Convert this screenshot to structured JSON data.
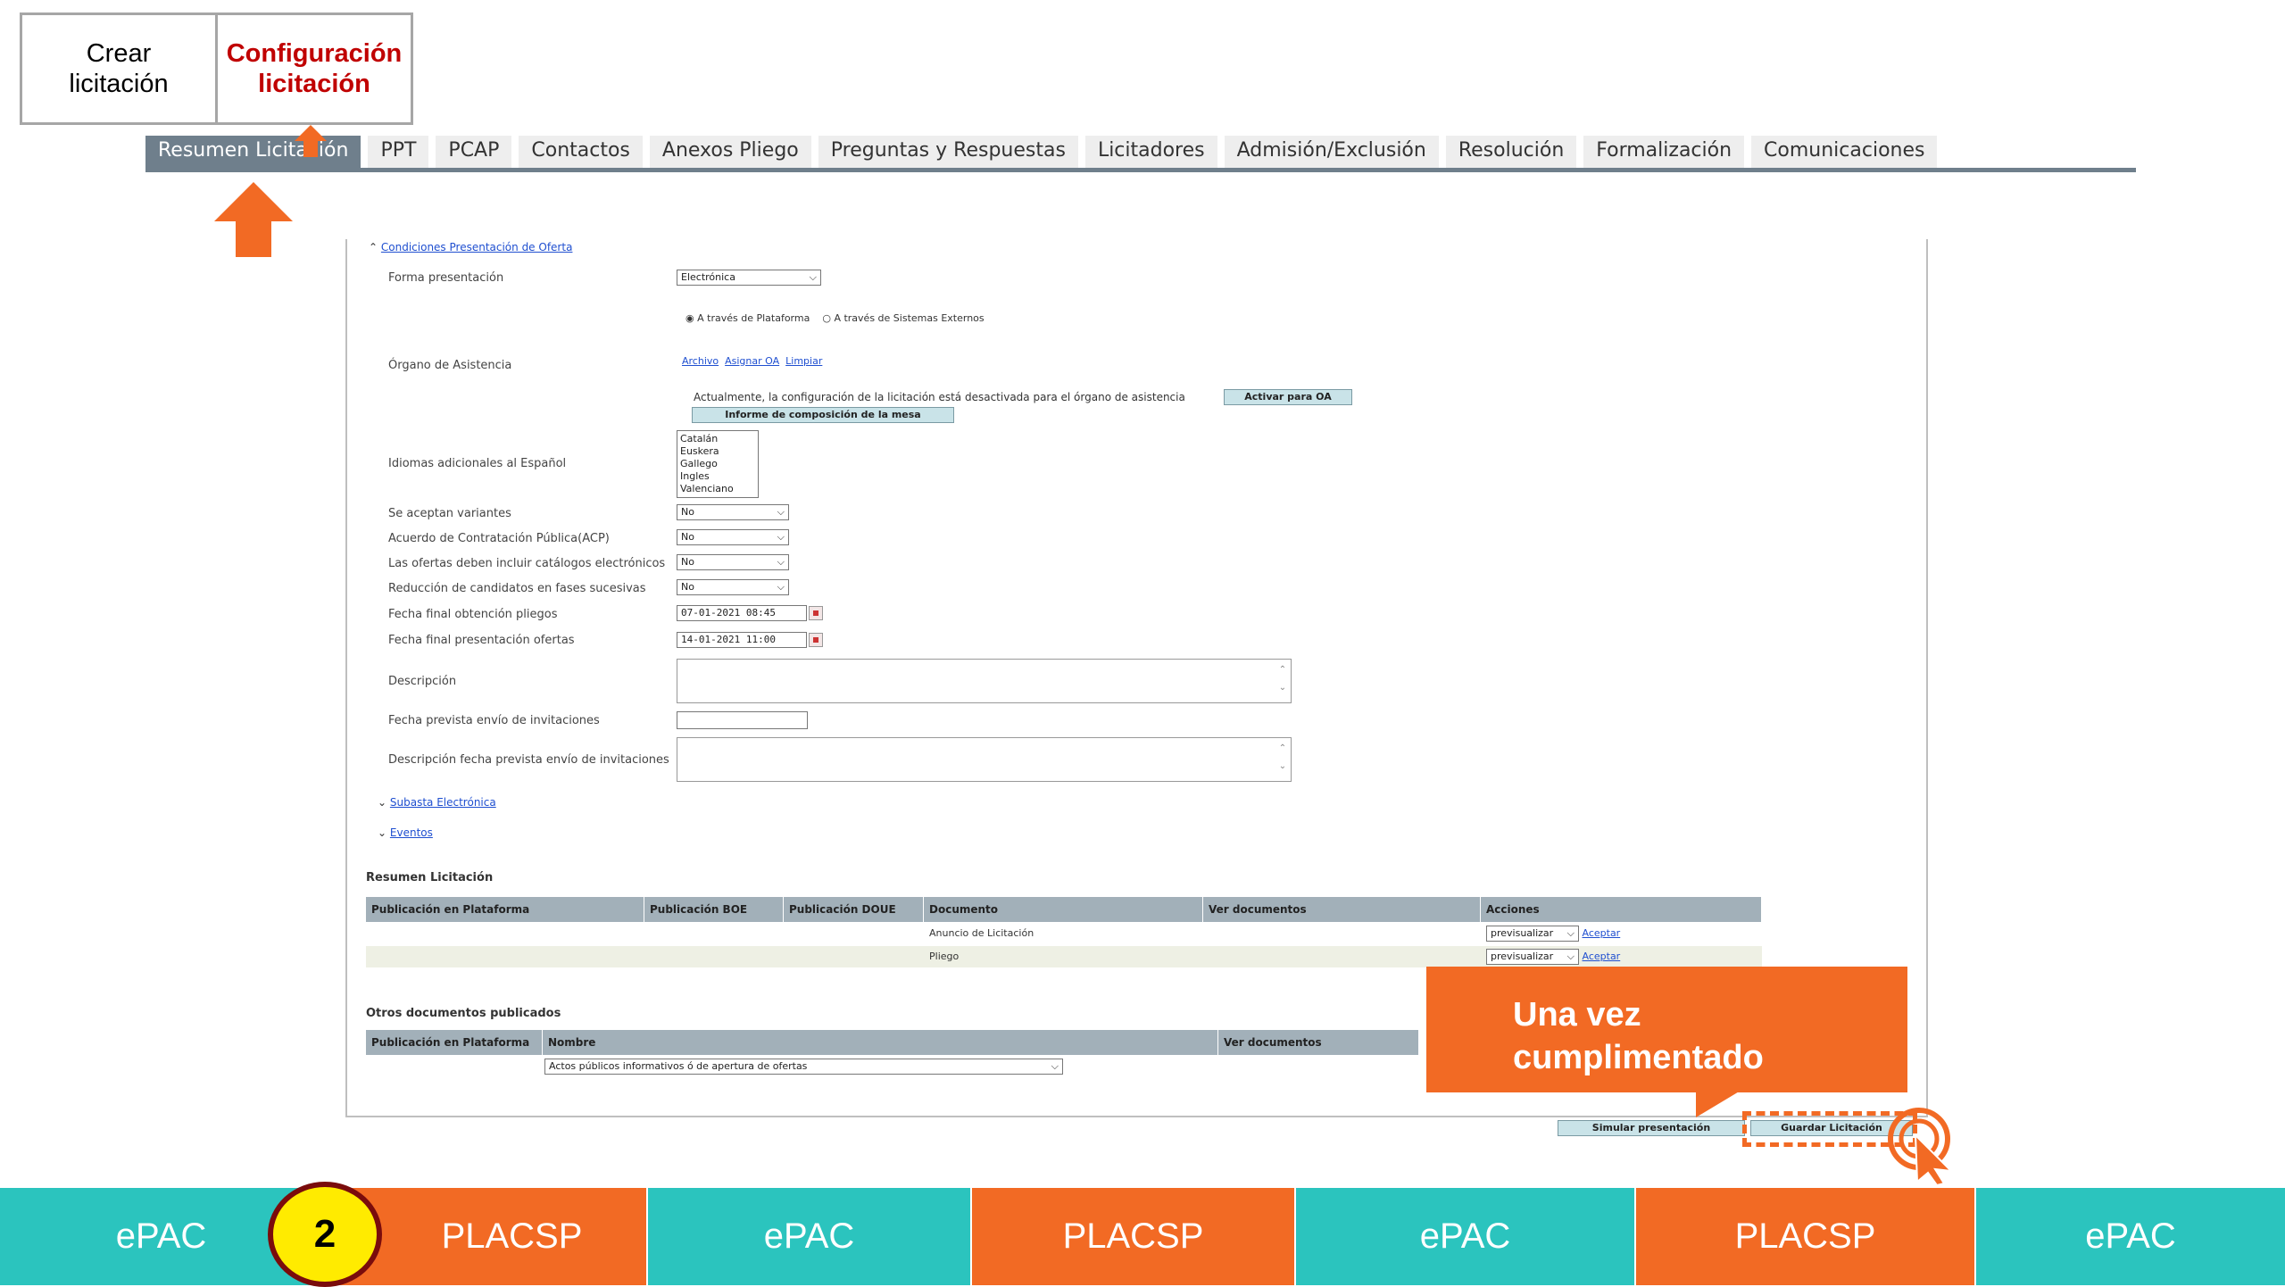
{
  "steps": {
    "first": "Crear\nlicitación",
    "second": "Configuración\nlicitación"
  },
  "tabs": [
    {
      "label": "Resumen Licitación",
      "active": true
    },
    {
      "label": "PPT",
      "active": false
    },
    {
      "label": "PCAP",
      "active": false
    },
    {
      "label": "Contactos",
      "active": false
    },
    {
      "label": "Anexos Pliego",
      "active": false
    },
    {
      "label": "Preguntas y Respuestas",
      "active": false
    },
    {
      "label": "Licitadores",
      "active": false
    },
    {
      "label": "Admisión/Exclusión",
      "active": false
    },
    {
      "label": "Resolución",
      "active": false
    },
    {
      "label": "Formalización",
      "active": false
    },
    {
      "label": "Comunicaciones",
      "active": false
    }
  ],
  "form": {
    "section_title": "Condiciones Presentación de Oferta",
    "forma_presentacion": {
      "label": "Forma presentación",
      "value": "Electrónica"
    },
    "radio_plataforma": "A través de Plataforma",
    "radio_externos": "A través de Sistemas Externos",
    "organo": {
      "label": "Órgano de Asistencia",
      "links": [
        "Archivo",
        "Asignar OA",
        "Limpiar"
      ]
    },
    "organo_note": "Actualmente, la configuración de la licitación está desactivada para el órgano de asistencia",
    "activar_oa": "Activar para OA",
    "informe": "Informe de composición de la mesa",
    "idiomas": {
      "label": "Idiomas adicionales al Español",
      "options": [
        "Catalán",
        "Euskera",
        "Gallego",
        "Ingles",
        "Valenciano"
      ]
    },
    "variantes": {
      "label": "Se aceptan variantes",
      "value": "No"
    },
    "acp": {
      "label": "Acuerdo de Contratación Pública(ACP)",
      "value": "No"
    },
    "catalogos": {
      "label": "Las ofertas deben incluir catálogos electrónicos",
      "value": "No"
    },
    "reduccion": {
      "label": "Reducción de candidatos en fases sucesivas",
      "value": "No"
    },
    "fecha_pliegos": {
      "label": "Fecha final obtención pliegos",
      "value": "07-01-2021 08:45"
    },
    "fecha_ofertas": {
      "label": "Fecha final presentación ofertas",
      "value": "14-01-2021 11:00"
    },
    "descripcion": {
      "label": "Descripción"
    },
    "fecha_invitaciones": {
      "label": "Fecha prevista envío de invitaciones"
    },
    "desc_invitaciones": {
      "label": "Descripción fecha prevista envío de invitaciones"
    },
    "subasta": "Subasta Electrónica",
    "eventos": "Eventos"
  },
  "resumen": {
    "title": "Resumen Licitación",
    "headers": [
      "Publicación en Plataforma",
      "Publicación BOE",
      "Publicación DOUE",
      "Documento",
      "Ver documentos",
      "Acciones"
    ],
    "rows": [
      {
        "documento": "Anuncio de Licitación",
        "accion": "previsualizar",
        "aceptar": "Aceptar"
      },
      {
        "documento": "Pliego",
        "accion": "previsualizar",
        "aceptar": "Aceptar"
      }
    ]
  },
  "otros": {
    "title": "Otros documentos publicados",
    "headers": [
      "Publicación en Plataforma",
      "Nombre",
      "Ver documentos"
    ],
    "select_value": "Actos públicos informativos ó de apertura de ofertas"
  },
  "buttons": {
    "simular": "Simular presentación",
    "guardar": "Guardar Licitación"
  },
  "callout": "Una vez\ncumplimentado",
  "bottom_nav": [
    {
      "label": "ePAC",
      "color": "teal"
    },
    {
      "label": "PLACSP",
      "color": "orange"
    },
    {
      "label": "ePAC",
      "color": "teal"
    },
    {
      "label": "PLACSP",
      "color": "orange"
    },
    {
      "label": "ePAC",
      "color": "teal"
    },
    {
      "label": "PLACSP",
      "color": "orange"
    },
    {
      "label": "ePAC",
      "color": "teal"
    }
  ],
  "step_number": "2",
  "colors": {
    "accent": "#f26a24",
    "teal": "#2bc4be",
    "tab_active": "#6f7f8c",
    "step_ring": "#7a0c0c",
    "step_fill": "#ffeb00"
  }
}
